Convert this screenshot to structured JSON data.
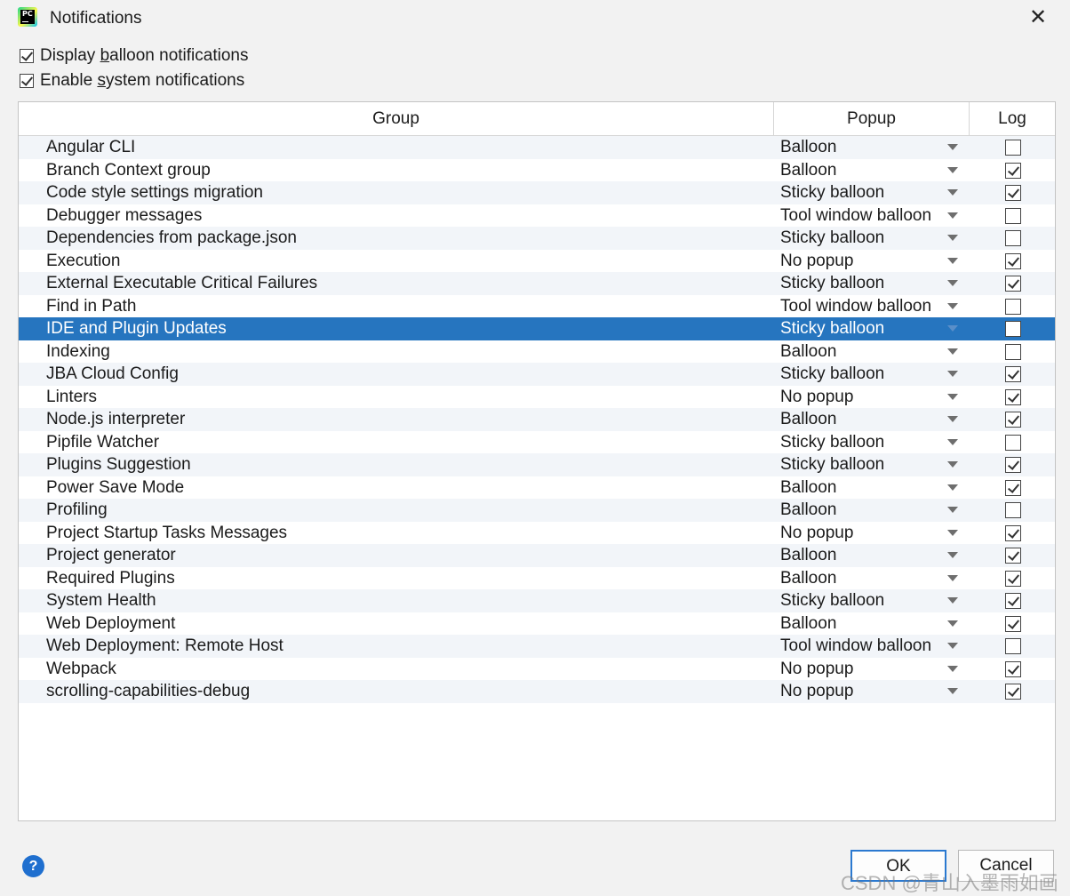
{
  "window": {
    "title": "Notifications"
  },
  "options": {
    "balloon": {
      "checked": true,
      "prefix": "Display ",
      "mnemonic": "b",
      "suffix": "alloon notifications"
    },
    "system": {
      "checked": true,
      "prefix": "Enable ",
      "mnemonic": "s",
      "suffix": "ystem notifications"
    }
  },
  "table": {
    "columns": [
      "Group",
      "Popup",
      "Log"
    ],
    "rows": [
      {
        "group": "Angular CLI",
        "popup": "Balloon",
        "log": false
      },
      {
        "group": "Branch Context group",
        "popup": "Balloon",
        "log": true
      },
      {
        "group": "Code style settings migration",
        "popup": "Sticky balloon",
        "log": true
      },
      {
        "group": "Debugger messages",
        "popup": "Tool window balloon",
        "log": false
      },
      {
        "group": "Dependencies from package.json",
        "popup": "Sticky balloon",
        "log": false
      },
      {
        "group": "Execution",
        "popup": "No popup",
        "log": true
      },
      {
        "group": "External Executable Critical Failures",
        "popup": "Sticky balloon",
        "log": true
      },
      {
        "group": "Find in Path",
        "popup": "Tool window balloon",
        "log": false
      },
      {
        "group": "IDE and Plugin Updates",
        "popup": "Sticky balloon",
        "log": false,
        "selected": true
      },
      {
        "group": "Indexing",
        "popup": "Balloon",
        "log": false
      },
      {
        "group": "JBA Cloud Config",
        "popup": "Sticky balloon",
        "log": true
      },
      {
        "group": "Linters",
        "popup": "No popup",
        "log": true
      },
      {
        "group": "Node.js interpreter",
        "popup": "Balloon",
        "log": true
      },
      {
        "group": "Pipfile Watcher",
        "popup": "Sticky balloon",
        "log": false
      },
      {
        "group": "Plugins Suggestion",
        "popup": "Sticky balloon",
        "log": true
      },
      {
        "group": "Power Save Mode",
        "popup": "Balloon",
        "log": true
      },
      {
        "group": "Profiling",
        "popup": "Balloon",
        "log": false
      },
      {
        "group": "Project Startup Tasks Messages",
        "popup": "No popup",
        "log": true
      },
      {
        "group": "Project generator",
        "popup": "Balloon",
        "log": true
      },
      {
        "group": "Required Plugins",
        "popup": "Balloon",
        "log": true
      },
      {
        "group": "System Health",
        "popup": "Sticky balloon",
        "log": true
      },
      {
        "group": "Web Deployment",
        "popup": "Balloon",
        "log": true
      },
      {
        "group": "Web Deployment: Remote Host",
        "popup": "Tool window balloon",
        "log": false
      },
      {
        "group": "Webpack",
        "popup": "No popup",
        "log": true
      },
      {
        "group": "scrolling-capabilities-debug",
        "popup": "No popup",
        "log": true
      }
    ]
  },
  "footer": {
    "help": "?",
    "ok": "OK",
    "cancel": "Cancel"
  },
  "watermark": "CSDN @青山入墨雨如画",
  "colors": {
    "selection": "#2675bf",
    "ok_border": "#2b79d0",
    "help": "#1f6fcf"
  },
  "icons": {
    "app": "pycharm-logo-icon",
    "close": "close-icon",
    "dropdown": "chevron-down-icon",
    "help": "help-icon"
  }
}
